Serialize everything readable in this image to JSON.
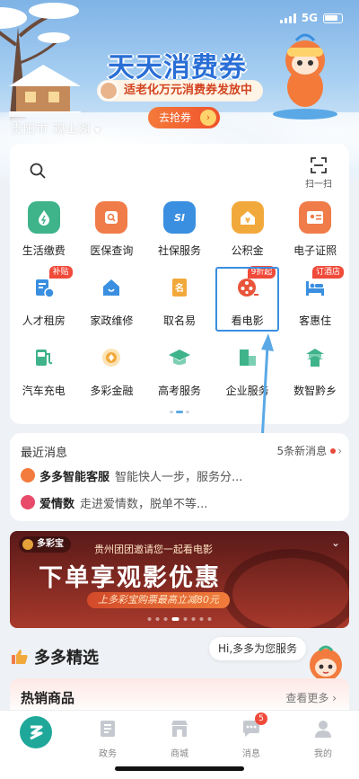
{
  "status_bar": {
    "network": "5G"
  },
  "banner": {
    "title": "天天消费券",
    "subtitle": "适老化万元消费券发放中",
    "cta": "去抢券",
    "location": "贵阳市 观山湖"
  },
  "services": {
    "scan_label": "扫一扫",
    "rows": [
      [
        {
          "label": "生活缴费",
          "icon": "water-drop-icon",
          "color": "#3fb38a"
        },
        {
          "label": "医保查询",
          "icon": "medical-search-icon",
          "color": "#f07c4a"
        },
        {
          "label": "社保服务",
          "icon": "social-security-icon",
          "color": "#3a8fe0",
          "glyph": "SI"
        },
        {
          "label": "公积金",
          "icon": "housing-fund-icon",
          "color": "#f2a93b",
          "glyph": "¥"
        },
        {
          "label": "电子证照",
          "icon": "id-card-icon",
          "color": "#f07c4a"
        }
      ],
      [
        {
          "label": "人才租房",
          "icon": "talent-housing-icon",
          "color": "#3a8fe0",
          "badge": "补贴"
        },
        {
          "label": "家政维修",
          "icon": "home-repair-icon",
          "color": "#3a8fe0"
        },
        {
          "label": "取名易",
          "icon": "name-icon",
          "color": "#f2a93b",
          "glyph": "名"
        },
        {
          "label": "看电影",
          "icon": "film-reel-icon",
          "color": "#e8553a",
          "badge": "9折起"
        },
        {
          "label": "客惠住",
          "icon": "hotel-bed-icon",
          "color": "#3a8fe0",
          "badge": "订酒店"
        }
      ],
      [
        {
          "label": "汽车充电",
          "icon": "ev-charger-icon",
          "color": "#3fb38a"
        },
        {
          "label": "多彩金融",
          "icon": "finance-coin-icon",
          "color": "#f2a93b"
        },
        {
          "label": "高考服务",
          "icon": "graduation-cap-icon",
          "color": "#3fb38a"
        },
        {
          "label": "企业服务",
          "icon": "enterprise-building-icon",
          "color": "#3fb38a"
        },
        {
          "label": "数智黔乡",
          "icon": "village-pavilion-icon",
          "color": "#3fb38a"
        }
      ]
    ]
  },
  "news": {
    "title": "最近消息",
    "count": "5条新消息",
    "items": [
      {
        "name": "多多智能客服",
        "text": "智能快人一步，服务分..."
      },
      {
        "name": "爱情数",
        "text": "走进爱情数，脱单不等..."
      }
    ]
  },
  "promo": {
    "brand": "多彩宝",
    "invite": "贵州团团邀请您一起看电影",
    "headline": "下单享观影优惠",
    "pill": "上多彩宝购票最高立减80元"
  },
  "featured": {
    "title": "多多精选",
    "chat_bubble": "Hi,多多为您服务",
    "hot_title": "热销商品",
    "hot_more": "查看更多"
  },
  "tabbar": {
    "tabs": [
      {
        "label": "",
        "icon": "home-logo-icon"
      },
      {
        "label": "政务",
        "icon": "government-icon"
      },
      {
        "label": "商城",
        "icon": "mall-icon"
      },
      {
        "label": "消息",
        "icon": "message-icon",
        "badge": "5"
      },
      {
        "label": "我的",
        "icon": "profile-icon"
      }
    ]
  },
  "colors": {
    "accent": "#1fa89a",
    "highlight": "#3a8fe0",
    "badge": "#f04a3a"
  }
}
